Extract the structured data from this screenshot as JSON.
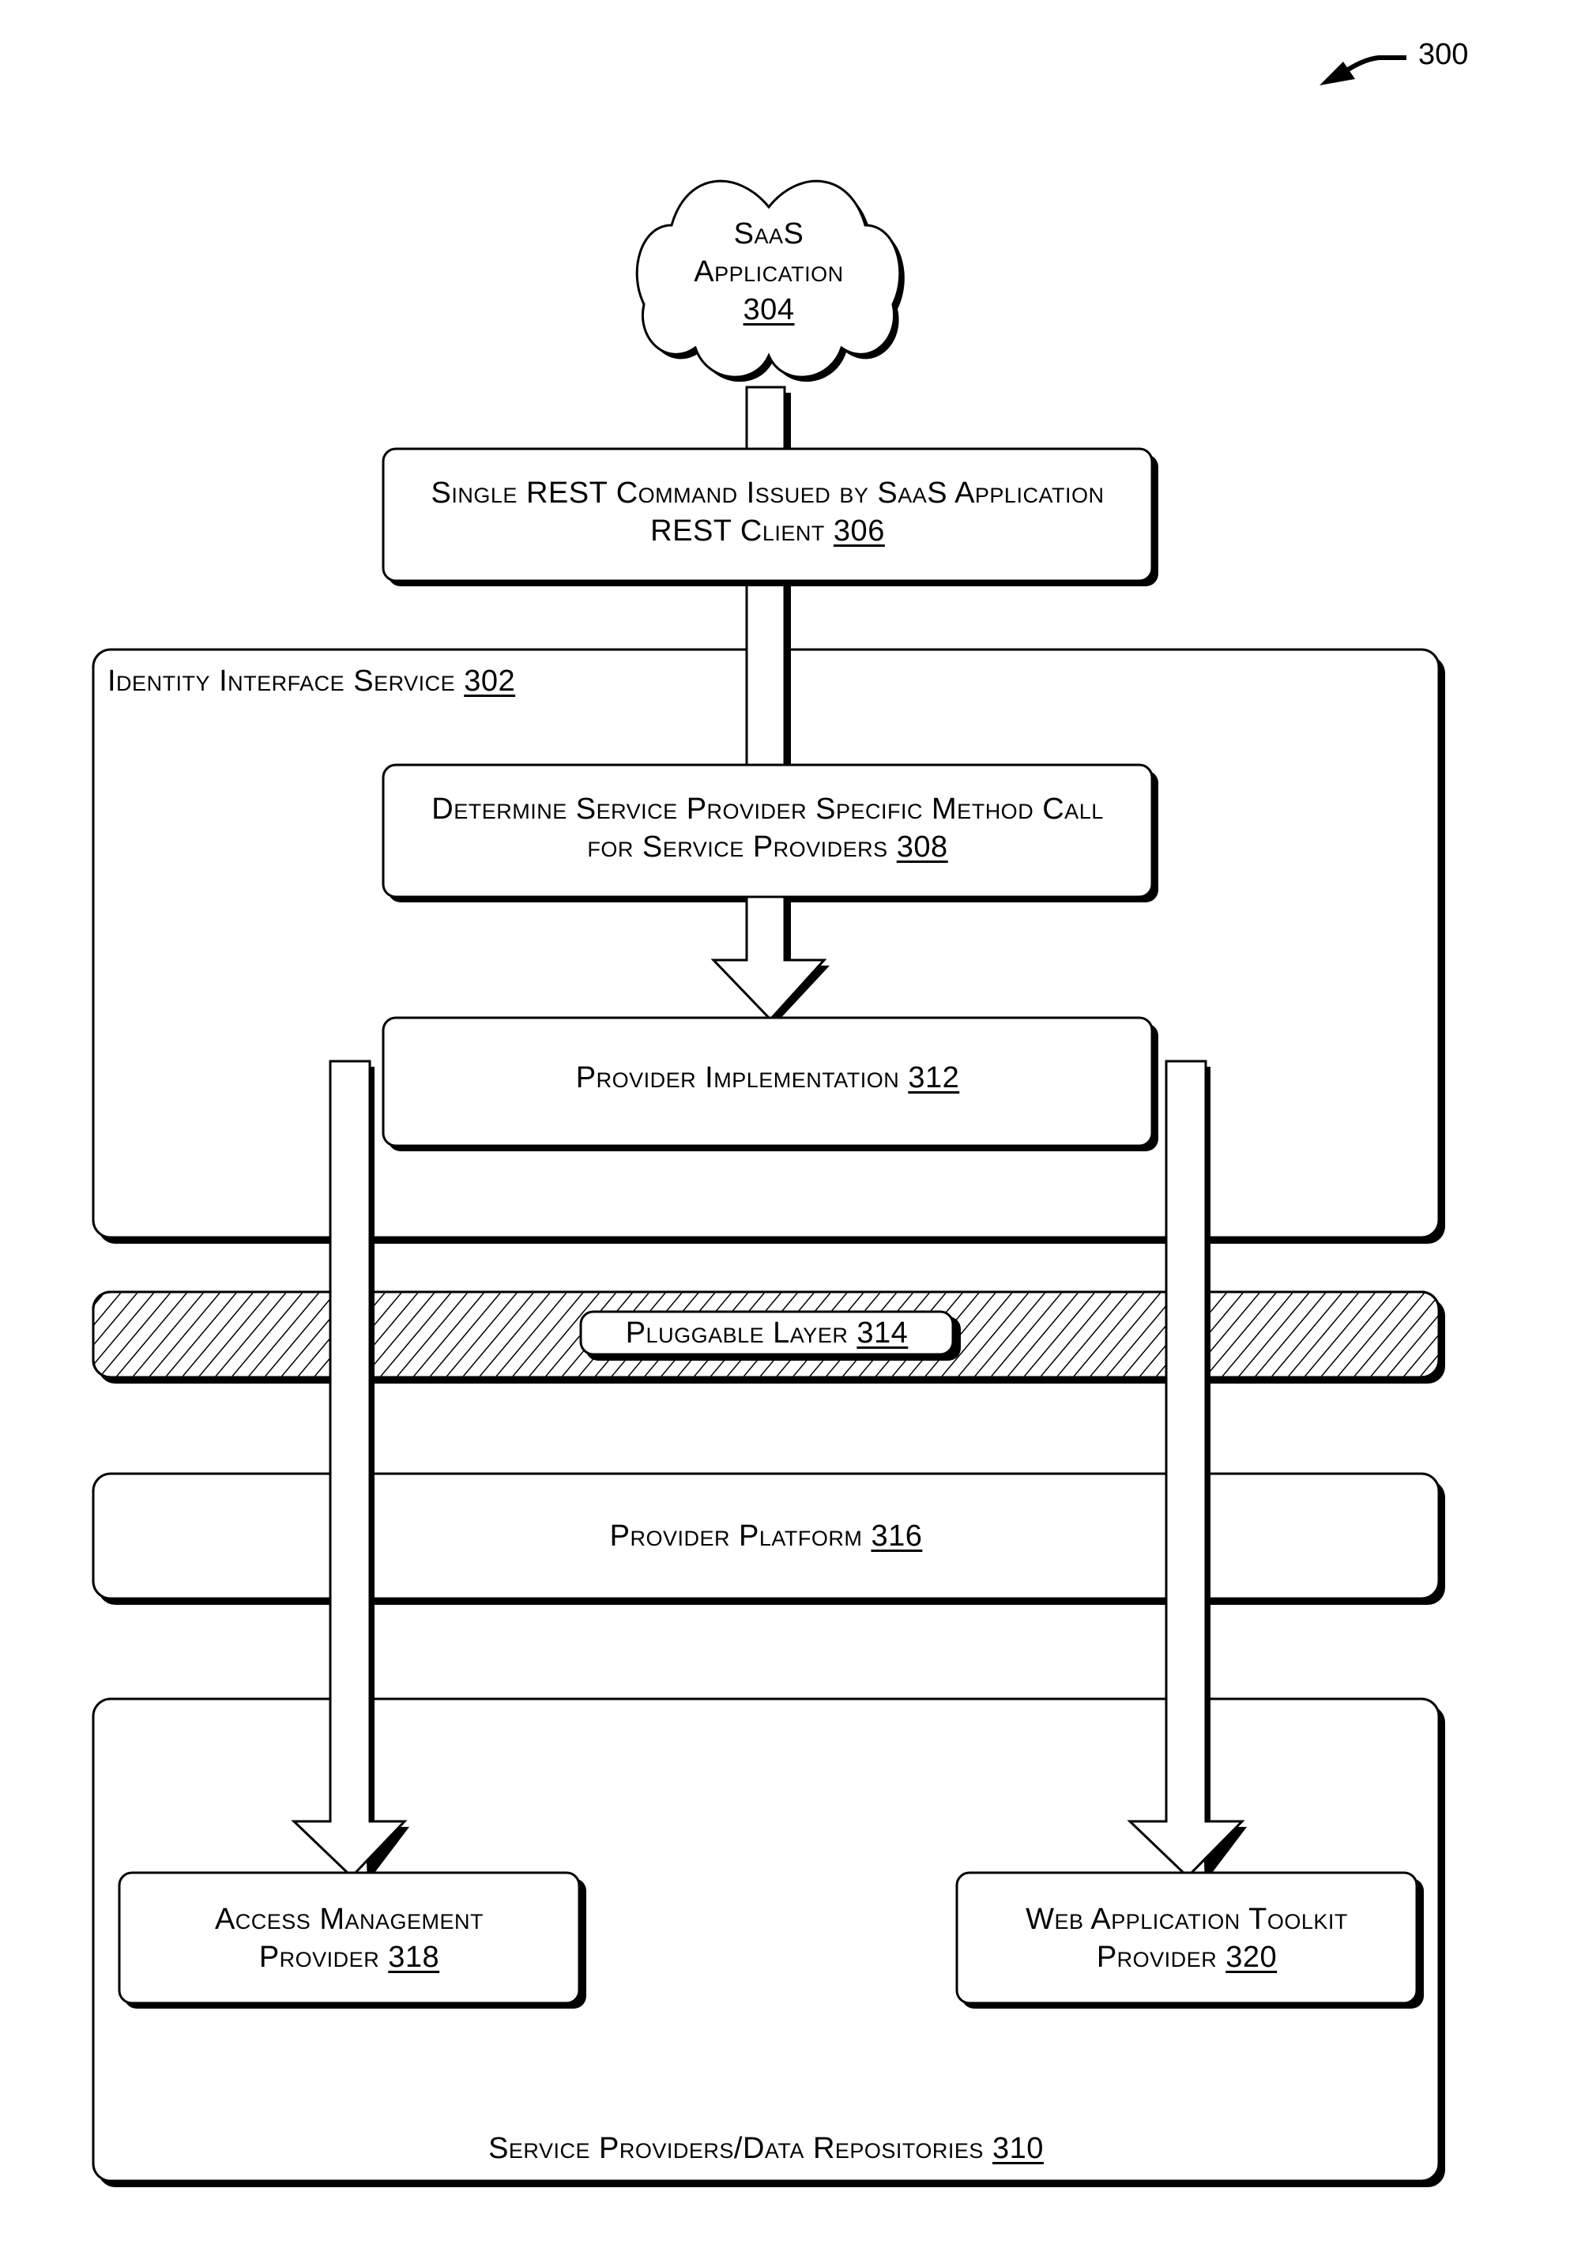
{
  "figure": {
    "reference_number": "300"
  },
  "nodes": {
    "saas_application": {
      "line1": "SaaS",
      "line2": "Application",
      "ref": "304",
      "shape": "cloud"
    },
    "rest_command": {
      "line1": "Single REST Command Issued by SaaS Application",
      "line2": "REST Client",
      "ref": "306"
    },
    "identity_interface_service": {
      "label": "Identity Interface Service",
      "ref": "302"
    },
    "determine_method_call": {
      "line1": "Determine Service Provider Specific Method Call",
      "line2": "for Service Providers",
      "ref": "308"
    },
    "provider_implementation": {
      "label": "Provider Implementation",
      "ref": "312"
    },
    "pluggable_layer": {
      "label": "Pluggable Layer",
      "ref": "314",
      "fill": "hatched"
    },
    "provider_platform": {
      "label": "Provider Platform",
      "ref": "316"
    },
    "service_providers_repositories": {
      "label": "Service Providers/Data Repositories",
      "ref": "310"
    },
    "access_management_provider": {
      "line1": "Access Management",
      "line2": "Provider",
      "ref": "318"
    },
    "web_app_toolkit_provider": {
      "line1": "Web Application Toolkit",
      "line2": "Provider",
      "ref": "320"
    }
  },
  "edges": [
    {
      "from": "saas_application",
      "to": "rest_command",
      "style": "connector"
    },
    {
      "from": "rest_command",
      "to": "determine_method_call",
      "style": "connector"
    },
    {
      "from": "determine_method_call",
      "to": "provider_implementation",
      "style": "block-arrow"
    },
    {
      "from": "provider_implementation",
      "to": "access_management_provider",
      "style": "block-arrow"
    },
    {
      "from": "provider_implementation",
      "to": "web_app_toolkit_provider",
      "style": "block-arrow"
    }
  ],
  "colors": {
    "line": "#000000",
    "fill": "#ffffff"
  }
}
